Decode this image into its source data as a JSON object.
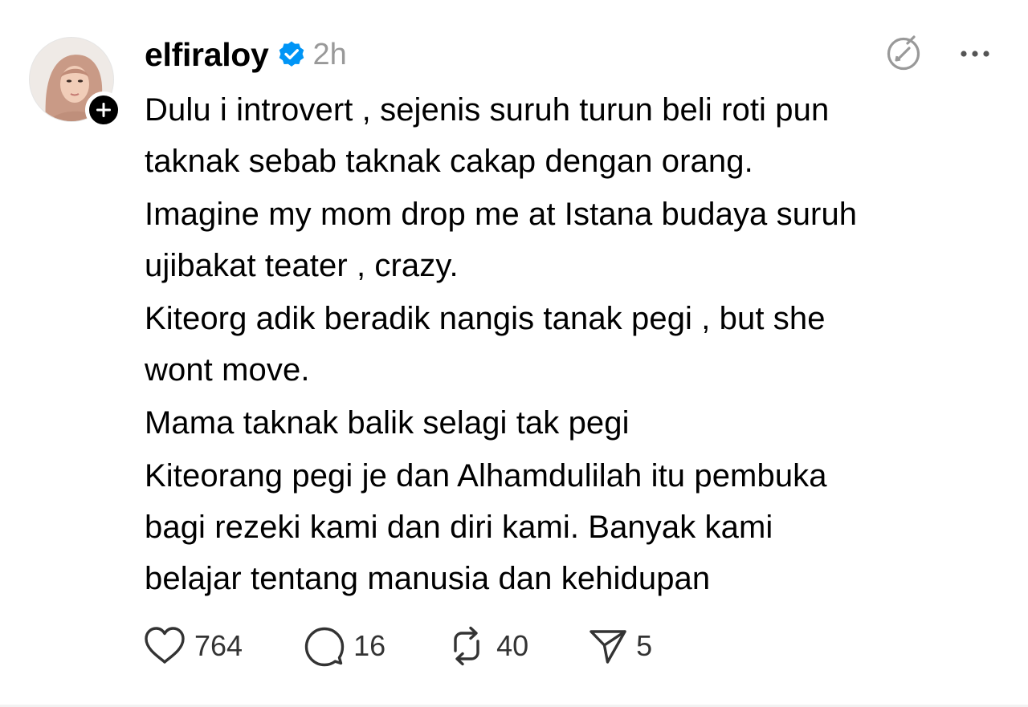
{
  "post": {
    "username": "elfiraloy",
    "timestamp": "2h",
    "verified": true,
    "paragraphs": [
      "Dulu i introvert , sejenis suruh turun beli roti pun\ntaknak sebab taknak cakap dengan orang.",
      "Imagine my mom drop me at Istana budaya suruh\nujibakat teater , crazy.",
      "Kiteorg adik beradik nangis tanak pegi , but she\nwont move.",
      "Mama taknak balik selagi tak pegi",
      "Kiteorang pegi je dan Alhamdulilah itu pembuka\nbagi rezeki kami dan diri kami. Banyak kami\nbelajar tentang manusia dan kehidupan"
    ],
    "actions": {
      "likes": "764",
      "replies": "16",
      "reposts": "40",
      "shares": "5"
    }
  },
  "icons": {
    "avatar": "avatar",
    "follow": "plus-icon",
    "verified": "verified-badge-icon",
    "edit": "edit-circle-icon",
    "more": "more-dots-icon",
    "like": "heart-icon",
    "reply": "comment-bubble-icon",
    "repost": "repost-icon",
    "share": "send-icon"
  },
  "colors": {
    "verified": "#0095F6",
    "muted": "#999999",
    "text": "#000000",
    "icon": "#333333"
  }
}
